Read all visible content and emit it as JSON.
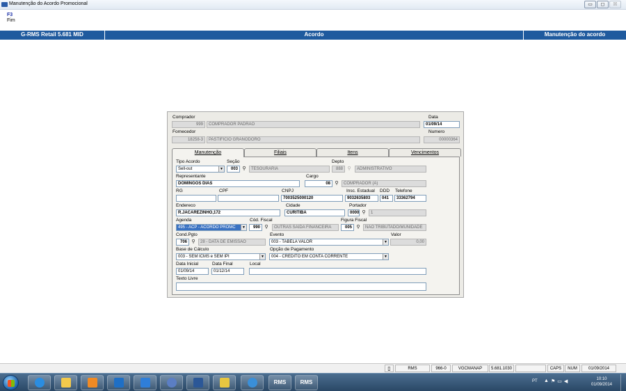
{
  "window": {
    "title": "Manutenção do Acordo Promocional",
    "min_label": "▭",
    "max_label": "◻",
    "close_label": "☒"
  },
  "toolbar": {
    "key": "F3",
    "label": "Fim"
  },
  "header": {
    "left": "G-RMS Retail 5.681 MID",
    "middle": "Acordo",
    "right": "Manutenção do acordo"
  },
  "form": {
    "comprador": {
      "label": "Comprador",
      "code": "999",
      "name": "COMPRADOR PADRAO"
    },
    "data": {
      "label": "Data",
      "value": "01/09/14"
    },
    "fornecedor": {
      "label": "Fornecedor",
      "code": "18258-3",
      "name": "PASTIFICIO GRANODORO"
    },
    "numero": {
      "label": "Numero",
      "value": "00000364"
    }
  },
  "tabs": [
    {
      "label": "Manutenção",
      "active": true
    },
    {
      "label": "Filiais",
      "active": false
    },
    {
      "label": "Itens",
      "active": false
    },
    {
      "label": "Vencimentos",
      "active": false
    }
  ],
  "manutencao": {
    "tipo_acordo": {
      "label": "Tipo Acordo",
      "value": "Sell-out"
    },
    "secao": {
      "label": "Seção",
      "code": "003",
      "name": "TESOURARIA"
    },
    "depto": {
      "label": "Depto",
      "code": "888",
      "name": "ADMINISTRATIVO"
    },
    "representante": {
      "label": "Representante",
      "value": "DOMINGOS DIAS"
    },
    "cargo": {
      "label": "Cargo",
      "code": "08",
      "name": "COMPRADOR (A)"
    },
    "rg": {
      "label": "RG",
      "value": ""
    },
    "cpf": {
      "label": "CPF",
      "value": ""
    },
    "cnpj": {
      "label": "CNPJ",
      "value": "7003525000120"
    },
    "insc_estadual": {
      "label": "Insc. Estadual",
      "value": "9032635803"
    },
    "ddd": {
      "label": "DDD",
      "value": "041"
    },
    "telefone": {
      "label": "Telefone",
      "value": "33362794"
    },
    "endereco": {
      "label": "Endereco",
      "value": "R.JACAREZINHO,172"
    },
    "cidade": {
      "label": "Cidade",
      "value": "CURITIBA"
    },
    "portador": {
      "label": "Portador",
      "code": "0000",
      "name": "1"
    },
    "agenda": {
      "label": "Agenda",
      "value": "495 - ACP - ACORDO PROMC"
    },
    "cod_fiscal": {
      "label": "Cód. Fiscal",
      "code": "990",
      "name": "OUTRAS SAIDA FINANCEIRA"
    },
    "figura_fiscal": {
      "label": "Figura Fiscal",
      "code": "005",
      "name": "NAO TRIBUTADO/MUNIDADE"
    },
    "cond_pgto": {
      "label": "Cond.Pgto",
      "code": "706",
      "name": "28 - DATA DE EMISSAO"
    },
    "evento": {
      "label": "Evento",
      "value": "003 - TABELA VALOR"
    },
    "valor": {
      "label": "Valor",
      "value": "0,00"
    },
    "base_calculo": {
      "label": "Base de Cálculo",
      "value": "003 - SEM ICMS e SEM IPI"
    },
    "opcao_pagamento": {
      "label": "Opção de Pagamento",
      "value": "004 - CRÉDITO EM CONTA CORRENTE"
    },
    "data_inicial": {
      "label": "Data Inicial",
      "value": "01/09/14"
    },
    "data_final": {
      "label": "Data Final",
      "value": "01/12/14"
    },
    "local": {
      "label": "Local",
      "value": ""
    },
    "texto_livre": {
      "label": "Texto Livre",
      "value": ""
    }
  },
  "statusbar": {
    "app": "RMS",
    "code": "966-0",
    "user": "VGCMANAP",
    "version": "5.681.1030",
    "caps": "CAPS",
    "num": "NUM",
    "date": "01/09/2014"
  },
  "taskbar": {
    "buttons": [
      "ie",
      "explorer",
      "media",
      "outlook",
      "lync",
      "app",
      "word",
      "app2",
      "chrome",
      "RMS",
      "RMS"
    ],
    "rms_label": "RMS",
    "tray": {
      "lang": "PT",
      "time": "10:10",
      "date": "01/09/2014"
    }
  }
}
